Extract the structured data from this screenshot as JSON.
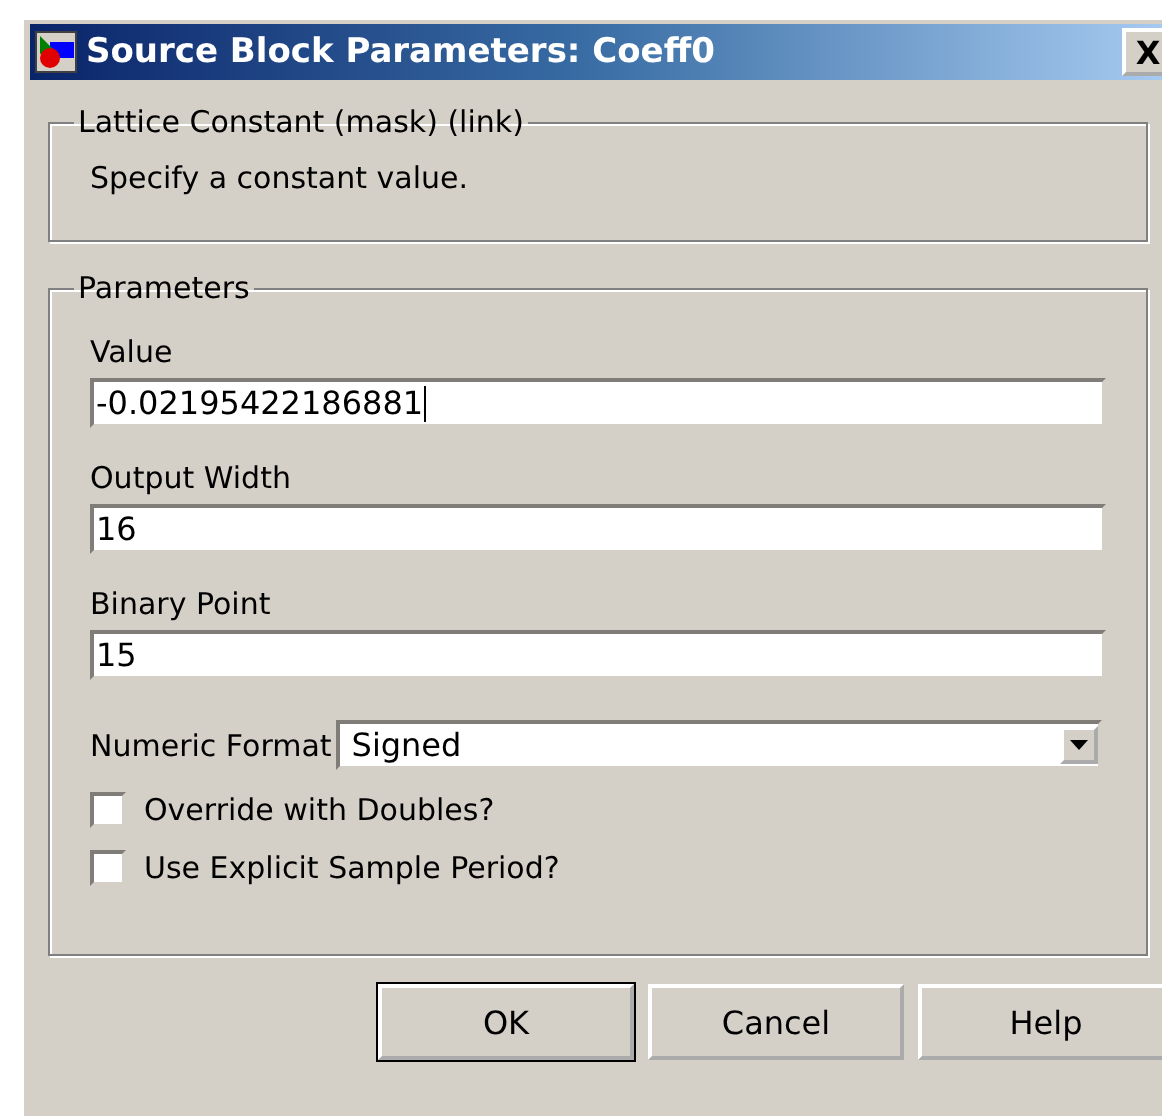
{
  "window": {
    "title": "Source Block Parameters: Coeff0",
    "close": "X"
  },
  "description_group": {
    "title": "Lattice Constant (mask) (link)",
    "text": "Specify a constant value."
  },
  "parameters_group": {
    "title": "Parameters",
    "fields": [
      {
        "kind": "text",
        "label": "Value",
        "value": "-0.02195422186881",
        "focused": true
      },
      {
        "kind": "text",
        "label": "Output Width",
        "value": "16",
        "focused": false
      },
      {
        "kind": "text",
        "label": "Binary Point",
        "value": "15",
        "focused": false
      },
      {
        "kind": "select",
        "label": "Numeric Format",
        "value": "Signed"
      },
      {
        "kind": "checkbox",
        "label": "Override with Doubles?",
        "checked": false
      },
      {
        "kind": "checkbox",
        "label": "Use Explicit Sample Period?",
        "checked": false
      }
    ]
  },
  "buttons": [
    {
      "label": "OK",
      "default": true
    },
    {
      "label": "Cancel",
      "default": false
    },
    {
      "label": "Help",
      "default": false
    }
  ]
}
